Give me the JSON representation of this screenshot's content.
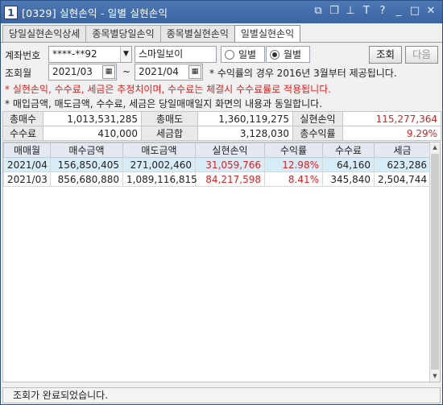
{
  "window": {
    "icon_label": "1",
    "title": "[0329] 실현손익 - 일별 실현손익",
    "icons": [
      "restore-icon",
      "copy-icon",
      "pin-icon",
      "font-icon",
      "help-icon",
      "minimize-icon",
      "maximize-icon",
      "close-icon"
    ],
    "icon_glyphs": [
      "⧉",
      "❐",
      "⊥",
      "T",
      "?",
      "_",
      "□",
      "✕"
    ]
  },
  "tabs": [
    {
      "label": "당일실현손익상세",
      "active": false
    },
    {
      "label": "종목별당일손익",
      "active": false
    },
    {
      "label": "종목별실현손익",
      "active": false
    },
    {
      "label": "일별실현손익",
      "active": true
    }
  ],
  "form": {
    "account_label": "계좌번호",
    "account_value": "****-**92",
    "account_name": "스마일보이",
    "radio_daily": "일별",
    "radio_monthly": "월별",
    "selected": "월별",
    "query_button": "조회",
    "next_button": "다음",
    "period_label": "조회월",
    "from": "2021/03",
    "tilde": "~",
    "to": "2021/04",
    "period_note": "* 수익률의 경우 2016년 3월부터 제공됩니다."
  },
  "notes": {
    "red": "* 실현손익, 수수료, 세금은 추정치이며, 수수료는 체결시 수수료률로 적용됩니다.",
    "black": "* 매입금액, 매도금액, 수수료, 세금은 당일매매일지 화면의 내용과 동일합니다."
  },
  "summary": {
    "row1": [
      {
        "label": "총매수",
        "value": "1,013,531,285"
      },
      {
        "label": "총매도",
        "value": "1,360,119,275"
      },
      {
        "label": "실현손익",
        "value": "115,277,364"
      }
    ],
    "row2": [
      {
        "label": "수수료",
        "value": "410,000"
      },
      {
        "label": "세금합",
        "value": "3,128,030"
      },
      {
        "label": "총수익률",
        "value": "9.29%"
      }
    ]
  },
  "grid": {
    "columns": [
      "매매월",
      "매수금액",
      "매도금액",
      "실현손익",
      "수익률",
      "수수료",
      "세금"
    ],
    "rows": [
      [
        "2021/04",
        "156,850,405",
        "271,002,460",
        "31,059,766",
        "12.98%",
        "64,160",
        "623,286"
      ],
      [
        "2021/03",
        "856,680,880",
        "1,089,116,815",
        "84,217,598",
        "8.41%",
        "345,840",
        "2,504,744"
      ]
    ]
  },
  "status": "조회가 완료되었습니다.",
  "colors": {
    "profit": "#e02020",
    "title_bar": "#3a64a2",
    "selected_row": "#d6ecf7"
  }
}
